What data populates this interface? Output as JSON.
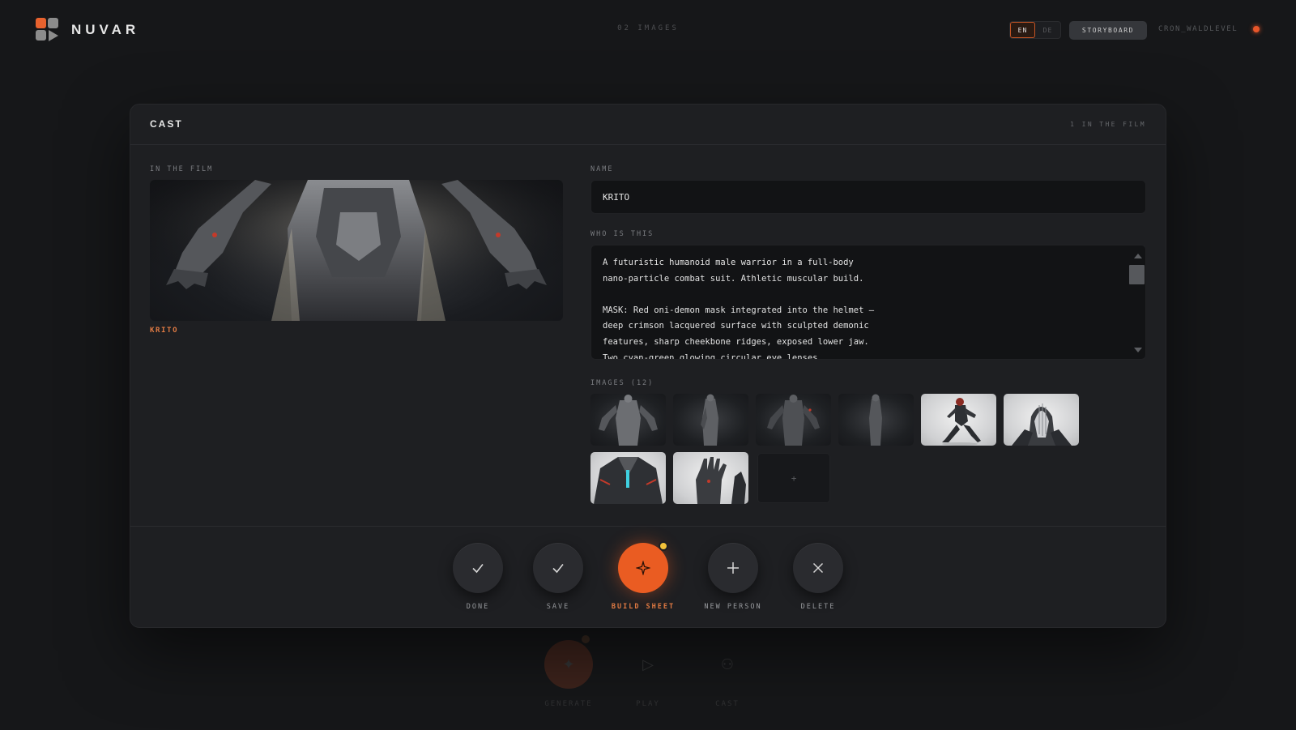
{
  "app": {
    "name": "NUVAR",
    "image_count_label": "02 IMAGES",
    "languages": [
      "EN",
      "DE"
    ],
    "active_language": "EN",
    "storyboard_label": "STORYBOARD",
    "user_name": "CRON_WALDLEVEL",
    "accent_color": "#ea5c22"
  },
  "modal": {
    "title": "CAST",
    "count_label": "1 IN THE FILM",
    "in_film": {
      "section_label": "IN THE FILM",
      "character_label": "KRITO"
    },
    "name_label": "NAME",
    "name_value": "KRITO",
    "description_label": "WHO IS THIS",
    "description_text": "A futuristic humanoid male warrior in a full-body\nnano-particle combat suit. Athletic muscular build.\n\nMASK: Red oni-demon mask integrated into the helmet —\ndeep crimson lacquered surface with sculpted demonic\nfeatures, sharp cheekbone ridges, exposed lower jaw.\nTwo cyan-green glowing circular eye lenses.",
    "images_label": "IMAGES (12)",
    "add_image_glyph": "+",
    "actions": [
      {
        "label": "DONE",
        "icon": "check-icon"
      },
      {
        "label": "SAVE",
        "icon": "check-icon"
      },
      {
        "label": "BUILD SHEET",
        "icon": "sparkle-icon"
      },
      {
        "label": "NEW PERSON",
        "icon": "plus-icon"
      },
      {
        "label": "DELETE",
        "icon": "close-icon"
      }
    ]
  },
  "background_dock": {
    "items": [
      {
        "label": "GENERATE",
        "icon": "sparkle-icon"
      },
      {
        "label": "PLAY",
        "icon": "play-icon"
      },
      {
        "label": "CAST",
        "icon": "people-icon"
      }
    ]
  }
}
